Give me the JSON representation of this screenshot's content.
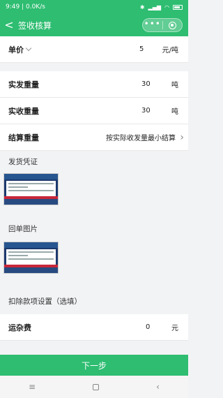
{
  "status": {
    "time": "9:49",
    "speed": "0.0K/s"
  },
  "nav": {
    "back_label": "<",
    "title": "签收核算"
  },
  "fields": {
    "unit_price": {
      "label": "单价",
      "value": "5",
      "unit": "元/吨"
    },
    "sent_weight": {
      "label": "实发重量",
      "value": "30",
      "unit": "吨"
    },
    "received_weight": {
      "label": "实收重量",
      "value": "30",
      "unit": "吨"
    },
    "settle_weight": {
      "label": "结算重量",
      "value": "按实际收发量最小结算"
    },
    "freight": {
      "label": "运杂费",
      "value": "0",
      "unit": "元"
    }
  },
  "sections": {
    "shipping_proof": "发货凭证",
    "receipt_image": "回单图片",
    "deduction": "扣除款项设置（选填）"
  },
  "next_button": "下一步",
  "colors": {
    "accent": "#2ebd71",
    "bg": "#f2f3f5"
  }
}
